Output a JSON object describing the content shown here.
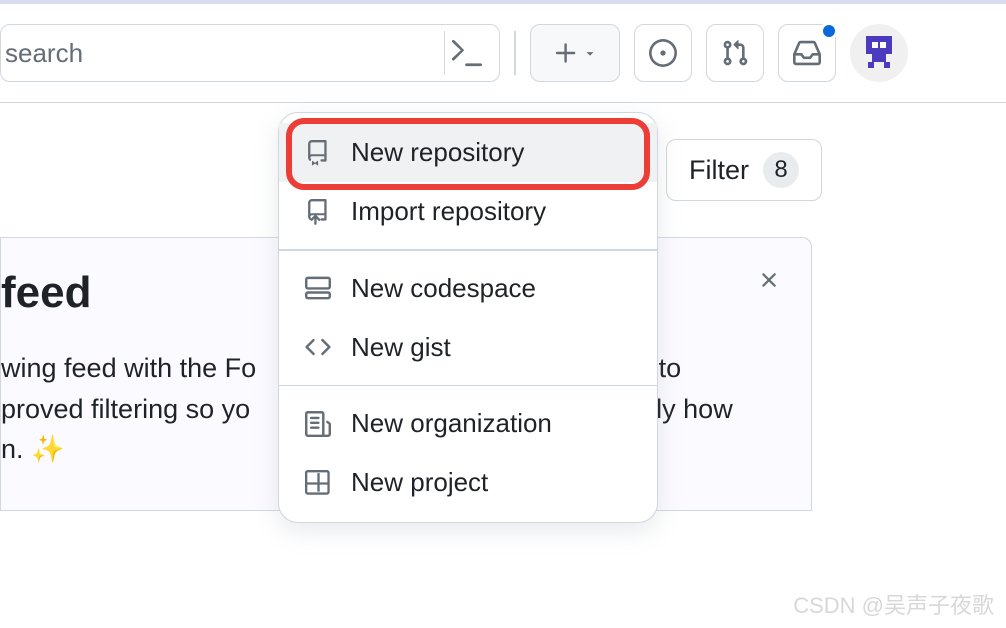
{
  "header": {
    "search_placeholder": "search"
  },
  "filter": {
    "label": "Filter",
    "count": "8"
  },
  "feed": {
    "title": "feed",
    "line1_a": "wing feed with the Fo",
    "line1_b": "e to",
    "line2_a": "proved filtering so yo",
    "line2_b": "actly how",
    "line3": "n. ✨"
  },
  "dropdown": {
    "items": [
      {
        "label": "New repository"
      },
      {
        "label": "Import repository"
      },
      {
        "label": "New codespace"
      },
      {
        "label": "New gist"
      },
      {
        "label": "New organization"
      },
      {
        "label": "New project"
      }
    ]
  },
  "watermark": "CSDN @吴声子夜歌"
}
